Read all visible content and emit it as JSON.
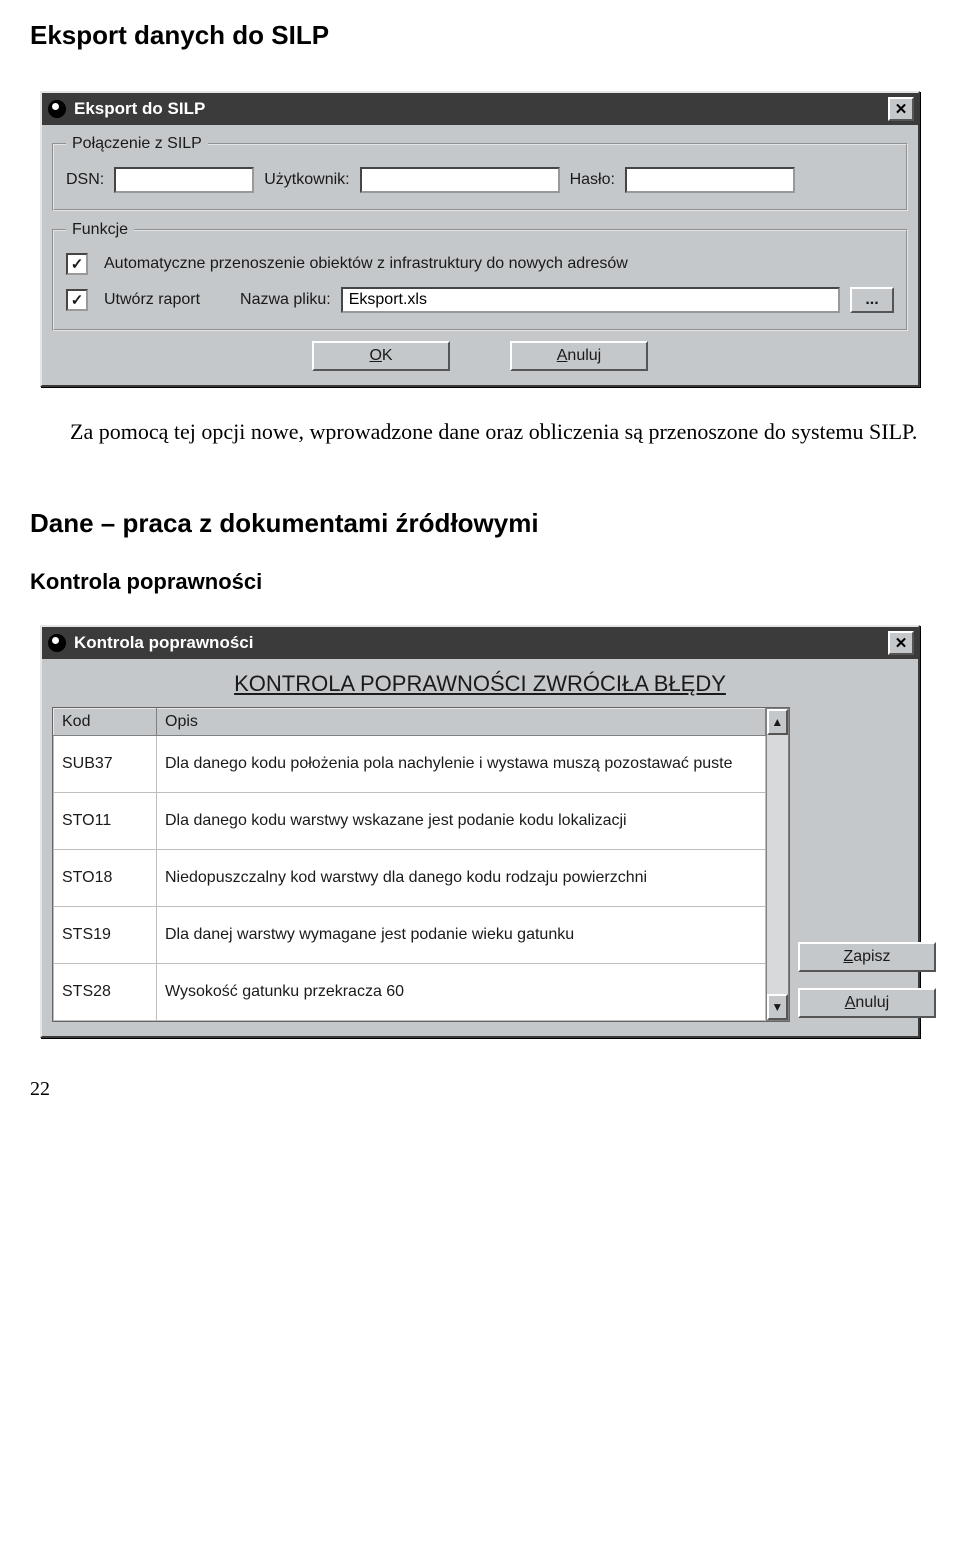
{
  "headings": {
    "h1": "Eksport danych do SILP",
    "body_paragraph": "Za pomocą tej opcji nowe, wprowadzone dane oraz obliczenia są przenoszone do systemu SILP.",
    "h2": "Dane – praca z dokumentami źródłowymi",
    "h3": "Kontrola poprawności",
    "page_number": "22"
  },
  "dialog1": {
    "title": "Eksport do SILP",
    "group_connection": {
      "legend": "Połączenie z SILP",
      "dsn_label": "DSN:",
      "dsn_value": "",
      "user_label": "Użytkownik:",
      "user_value": "",
      "pass_label": "Hasło:",
      "pass_value": ""
    },
    "group_functions": {
      "legend": "Funkcje",
      "chk1_label": "Automatyczne przenoszenie obiektów z infrastruktury do nowych adresów",
      "chk2_label": "Utwórz raport",
      "filename_label": "Nazwa pliku:",
      "filename_value": "Eksport.xls",
      "browse_label": "..."
    },
    "buttons": {
      "ok": "OK",
      "cancel": "Anuluj"
    }
  },
  "dialog2": {
    "title": "Kontrola poprawności",
    "banner": "KONTROLA POPRAWNOŚCI ZWRÓCIŁA BŁĘDY",
    "columns": {
      "code": "Kod",
      "desc": "Opis"
    },
    "rows": [
      {
        "code": "SUB37",
        "desc": "Dla danego kodu położenia pola nachylenie i wystawa muszą pozostawać puste"
      },
      {
        "code": "STO11",
        "desc": "Dla danego kodu warstwy  wskazane jest  podanie kodu lokalizacji"
      },
      {
        "code": "STO18",
        "desc": "Niedopuszczalny kod warstwy dla danego kodu rodzaju powierzchni"
      },
      {
        "code": "STS19",
        "desc": "Dla danej warstwy wymagane jest podanie wieku gatunku"
      },
      {
        "code": "STS28",
        "desc": "Wysokość gatunku przekracza 60"
      }
    ],
    "buttons": {
      "save": "Zapisz",
      "cancel": "Anuluj"
    }
  }
}
